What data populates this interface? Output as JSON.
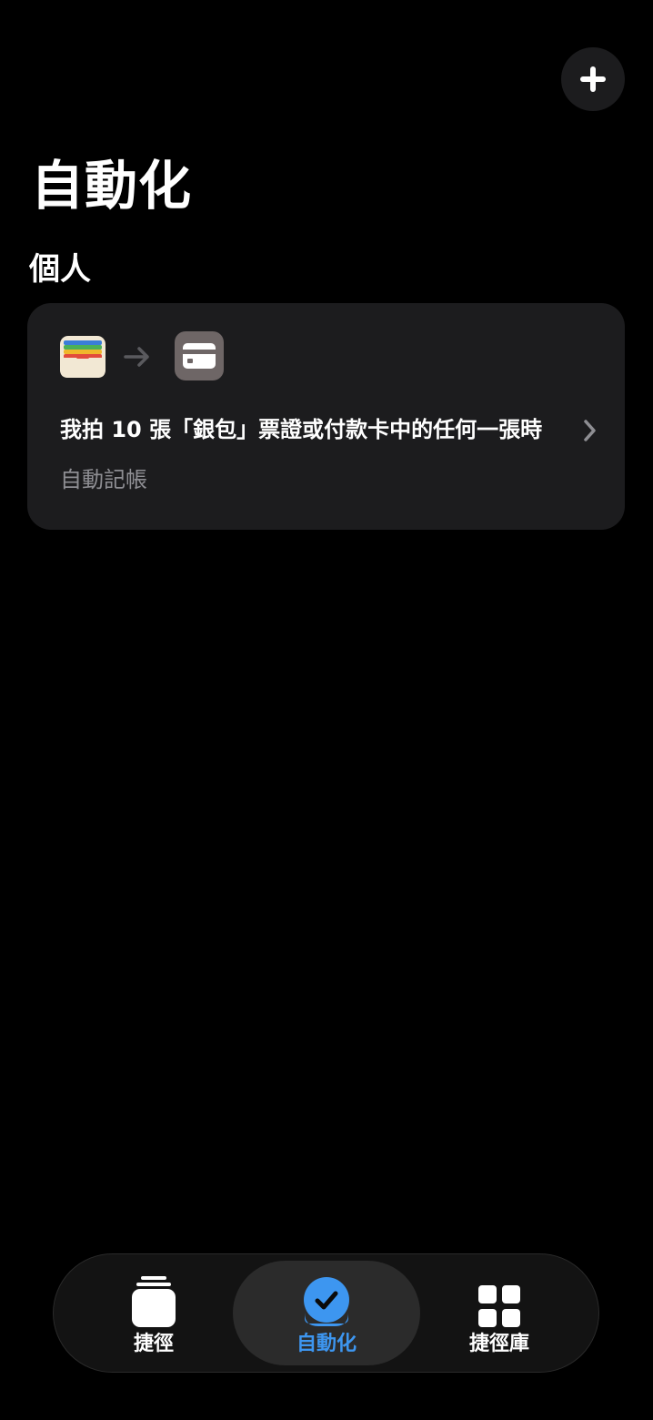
{
  "header": {
    "title": "自動化",
    "add_icon": "plus-icon"
  },
  "section": {
    "title": "個人"
  },
  "automation_card": {
    "trigger_icon": "wallet-icon",
    "arrow_icon": "arrow-right-icon",
    "action_icon": "credit-card-icon",
    "trigger_text": "我拍 10 張「銀包」票證或付款卡中的任何一張時",
    "action_text": "自動記帳",
    "chevron_icon": "chevron-right-icon"
  },
  "tab_bar": {
    "accent_color": "#3d96f0",
    "tabs": [
      {
        "label": "捷徑",
        "icon": "stack-icon",
        "selected": false
      },
      {
        "label": "自動化",
        "icon": "checkmark-circle-icon",
        "selected": true
      },
      {
        "label": "捷徑庫",
        "icon": "grid-icon",
        "selected": false
      }
    ]
  }
}
